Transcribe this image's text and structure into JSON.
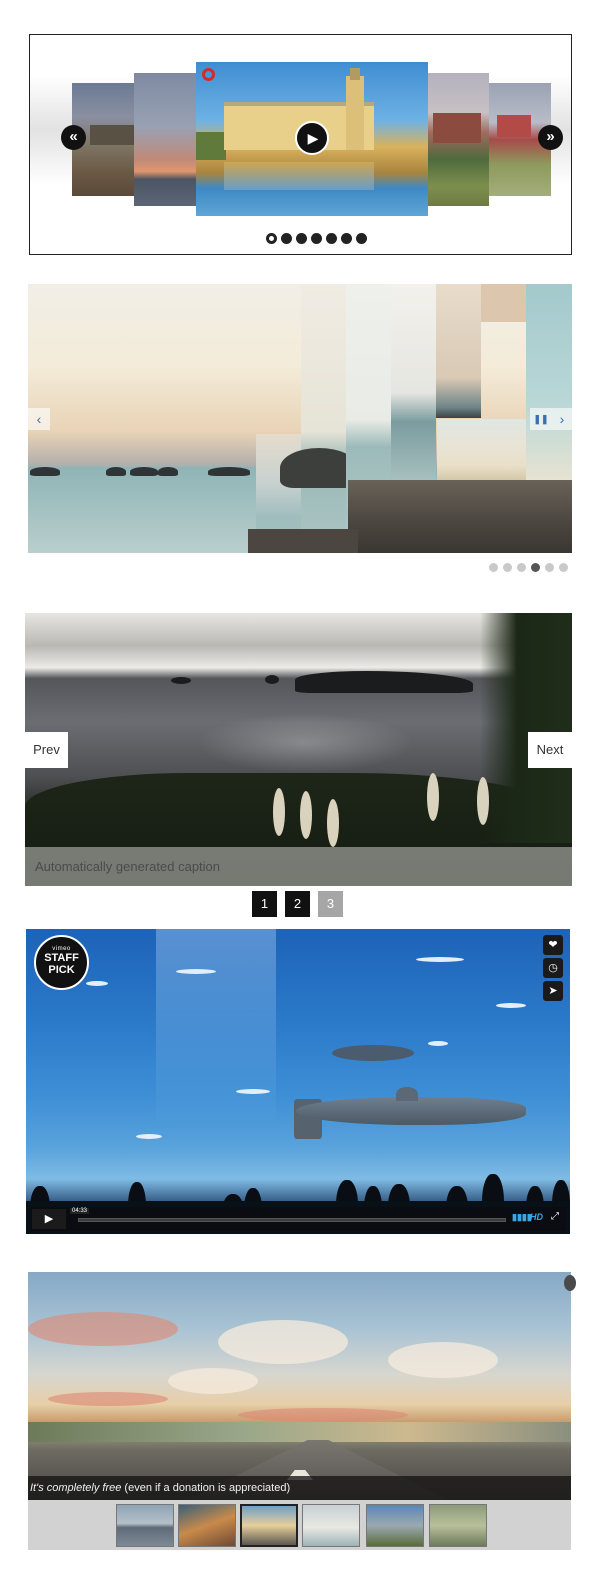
{
  "slider1": {
    "prev_icon": "double-chevron-left-icon",
    "next_icon": "double-chevron-right-icon",
    "prev_glyph": "«",
    "next_glyph": "»",
    "play_glyph": "▶",
    "dots": 7,
    "active_dot": 0
  },
  "slider2": {
    "prev_glyph": "‹",
    "pause_glyph": "❚❚",
    "next_glyph": "›",
    "dots": 6,
    "active_dot": 3
  },
  "slider3": {
    "prev_label": "Prev",
    "next_label": "Next",
    "caption": "Automatically generated caption",
    "pages": [
      "1",
      "2",
      "3"
    ],
    "disabled_page": 2
  },
  "slider4": {
    "badge_small": "vimeo",
    "badge_line1": "STAFF",
    "badge_line2": "PICK",
    "icons": [
      "heart-icon",
      "clock-icon",
      "send-icon"
    ],
    "icon_glyphs": [
      "❤",
      "◷",
      "➤"
    ],
    "play_glyph": "▶",
    "time": "04:33",
    "volume_glyph": "▮▮▮▮",
    "hd_label": "HD",
    "fullscreen_glyph": "⤢"
  },
  "slider5": {
    "caption_italic": "It's completely free",
    "caption_rest": " (even if a donation is appreciated)",
    "thumbnails": 6,
    "active_thumbnail": 2
  },
  "colors": {
    "s1_dot": "#222222",
    "s2_dot_active": "#555555",
    "s2_dot": "#c9c9c9",
    "s2_nav": "#3a6fb4",
    "s3_page": "#111111",
    "s3_page_disabled": "#a6a6a6",
    "s4_accent": "#39a6e8"
  }
}
